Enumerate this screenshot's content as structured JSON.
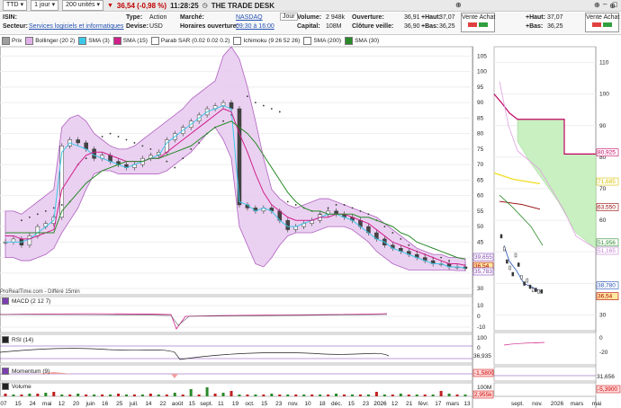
{
  "toolbar": {
    "symbol": "TTD",
    "period": "1 jour",
    "units": "200 unités",
    "change": "36,54 (-0,98 %)",
    "time": "11:28:25",
    "name": "THE TRADE DESK"
  },
  "info": {
    "isin_label": "ISIN:",
    "sector_label": "Secteur:",
    "sector_value": "Services logiciels et informatiques",
    "type_label": "Type:",
    "type_value": "Action",
    "devise_label": "Devise:",
    "devise_value": "USD",
    "market_label": "Marché:",
    "market_value": "NASDAQ",
    "hours_label": "Horaires ouverture:",
    "hours_value": "09:30 à 16:00",
    "jour": "Jour",
    "volume_label": "Volume:",
    "volume_value": "2 948k",
    "capital_label": "Capital:",
    "capital_value": "108M",
    "open_label": "Ouverture:",
    "open_value": "36,91",
    "close_label": "Clôture veille:",
    "close_value": "36,90",
    "high_label": "+Haut:",
    "high_value": "37,07",
    "low_label": "+Bas:",
    "low_value": "36,25",
    "va_label": "Vente Achat",
    "high2_label": "+Haut:",
    "high2_value": "37,07",
    "low2_label": "+Bas:",
    "low2_value": "36,25",
    "va2_label": "Vente Achat"
  },
  "legend": [
    "Prix",
    "Bollinger (20 2)",
    "SMA (3)",
    "SMA (15)",
    "Parab SAR (0.02 0.02 0.2)",
    "Ichimoku (9 26 52 26)",
    "SMA (200)",
    "SMA (30)"
  ],
  "legend_colors": [
    "#9e9e9e",
    "#e0b0e8",
    "#3ec8e8",
    "#d0208a",
    "#ffffff",
    "#ffffff",
    "#ffffff",
    "#2a8a2a"
  ],
  "watermark": "ProRealTime.com - Différé 15min",
  "panels": {
    "macd": "MACD (2 12 7)",
    "rsi": "RSI (14)",
    "momentum": "Momentum (9)",
    "volume": "Volume"
  },
  "right_labels": {
    "main": [
      {
        "text": "39,655",
        "color": "#7c3fb0"
      },
      {
        "text": "36,54",
        "color": "#b00000"
      },
      {
        "text": "35,783",
        "color": "#7c3fb0"
      }
    ],
    "rsi": "36,935",
    "momentum": "-1,5800",
    "volume": "2,955k"
  },
  "right_labels2": {
    "main": [
      {
        "text": "80,925",
        "color": "#c00060"
      },
      {
        "text": "71,685",
        "color": "#d8c000"
      },
      {
        "text": "63,550",
        "color": "#900000"
      },
      {
        "text": "51,956",
        "color": "#2a8a2a"
      },
      {
        "text": "51,165",
        "color": "#c080d0"
      },
      {
        "text": "38,780",
        "color": "#2451b3"
      },
      {
        "text": "36,54",
        "color": "#b00000"
      }
    ],
    "momentum": "31,656",
    "volume": "-5,3900"
  },
  "chart_data": {
    "type": "line",
    "title": "",
    "price_axis": [
      105,
      100,
      95,
      90,
      85,
      80,
      75,
      70,
      65,
      60,
      55,
      50,
      45,
      40,
      35,
      30
    ],
    "price_axis2": [
      110,
      100,
      90,
      80,
      70,
      60,
      50,
      40,
      30
    ],
    "macd_axis": [
      10,
      0,
      -10
    ],
    "macd_axis2": [
      -20
    ],
    "rsi_axis": [
      100,
      0
    ],
    "rsi_axis2": [
      0,
      -20
    ],
    "volume_axis": [
      "100M",
      "0"
    ],
    "x_labels": [
      "07",
      "15",
      "24",
      "mai",
      "12",
      "20",
      "juin",
      "16",
      "25",
      "juil.",
      "14",
      "22",
      "août",
      "15",
      "sept.",
      "11",
      "19",
      "oct.",
      "15",
      "23",
      "nov.",
      "10",
      "18",
      "déc.",
      "15",
      "23",
      "2026",
      "12",
      "21",
      "févr.",
      "17",
      "mars",
      "13"
    ],
    "x_labels2": [
      "sept.",
      "nov.",
      "2026",
      "mars",
      "mai"
    ],
    "series": [
      {
        "name": "Prix",
        "values": [
          45,
          46,
          44,
          47,
          50,
          51,
          53,
          76,
          78,
          77,
          75,
          72,
          73,
          71,
          70,
          69,
          70,
          72,
          73,
          74,
          78,
          80,
          82,
          84,
          86,
          88,
          89,
          90,
          88,
          57,
          56,
          55,
          56,
          55,
          52,
          49,
          50,
          51,
          52,
          54,
          55,
          54,
          53,
          52,
          50,
          48,
          46,
          44,
          43,
          42,
          41,
          40,
          39,
          38,
          38,
          37,
          37,
          36.5
        ]
      },
      {
        "name": "SMA (3)",
        "values": [
          45,
          45,
          45,
          46,
          48,
          50,
          52,
          74,
          77,
          76,
          75,
          73,
          72,
          71,
          70,
          69,
          70,
          71,
          72,
          73,
          77,
          79,
          81,
          83,
          85,
          87,
          88,
          89,
          88,
          58,
          57,
          55,
          56,
          55,
          52,
          50,
          50,
          51,
          52,
          53,
          54,
          54,
          53,
          52,
          50,
          48,
          46,
          45,
          43,
          42,
          41,
          40,
          39,
          38,
          38,
          37,
          37,
          36.6
        ]
      },
      {
        "name": "SMA (15)",
        "values": [
          47,
          47,
          46,
          46,
          47,
          48,
          49,
          62,
          66,
          70,
          73,
          74,
          74,
          73,
          72,
          71,
          71,
          71,
          72,
          72,
          74,
          76,
          78,
          80,
          82,
          84,
          86,
          88,
          87,
          80,
          74,
          67,
          61,
          57,
          55,
          53,
          52,
          52,
          52,
          53,
          53,
          54,
          54,
          53,
          52,
          51,
          49,
          47,
          45,
          44,
          43,
          42,
          41,
          40,
          39,
          38,
          38,
          37.5
        ]
      },
      {
        "name": "SMA (30)",
        "values": [
          48,
          48,
          48,
          48,
          48,
          48,
          48,
          55,
          58,
          61,
          64,
          66,
          68,
          69,
          70,
          71,
          71,
          71,
          72,
          72,
          73,
          74,
          75,
          76,
          78,
          80,
          82,
          83,
          84,
          82,
          80,
          77,
          73,
          69,
          65,
          61,
          58,
          56,
          55,
          55,
          54,
          54,
          54,
          54,
          53,
          53,
          52,
          51,
          50,
          48,
          47,
          45,
          44,
          43,
          42,
          41,
          40,
          39.5
        ]
      },
      {
        "name": "Bollinger (20 2)",
        "upper": [
          55,
          55,
          54,
          56,
          58,
          60,
          62,
          82,
          85,
          86,
          84,
          80,
          78,
          76,
          75,
          75,
          76,
          78,
          80,
          82,
          84,
          86,
          88,
          91,
          93,
          95,
          97,
          105,
          108,
          104,
          95,
          84,
          72,
          62,
          59,
          57,
          56,
          57,
          58,
          59,
          59,
          58,
          57,
          56,
          55,
          54,
          53,
          51,
          49,
          47,
          45,
          43,
          42,
          41,
          41,
          40,
          40,
          39.6
        ],
        "lower": [
          40,
          40,
          39,
          39,
          40,
          41,
          43,
          48,
          52,
          56,
          62,
          67,
          68,
          68,
          67,
          67,
          67,
          67,
          67,
          67,
          68,
          70,
          72,
          74,
          77,
          80,
          82,
          78,
          72,
          50,
          44,
          38,
          37,
          40,
          44,
          47,
          48,
          48,
          48,
          49,
          50,
          50,
          50,
          49,
          47,
          45,
          42,
          40,
          38,
          37,
          36,
          36,
          36,
          36,
          36,
          36,
          35.8,
          35.8
        ]
      }
    ],
    "sar": [
      52,
      53,
      54,
      55,
      56,
      57,
      58,
      70,
      72,
      74,
      79,
      80,
      79,
      78,
      77,
      76,
      75,
      73,
      71,
      69,
      72,
      75,
      77,
      80,
      82,
      84,
      86,
      87,
      92,
      90,
      89,
      88,
      87,
      58,
      57,
      56,
      55,
      54,
      56,
      57,
      57,
      56,
      55,
      54,
      52,
      50,
      48,
      46,
      44,
      42,
      41,
      40,
      40,
      39
    ]
  }
}
